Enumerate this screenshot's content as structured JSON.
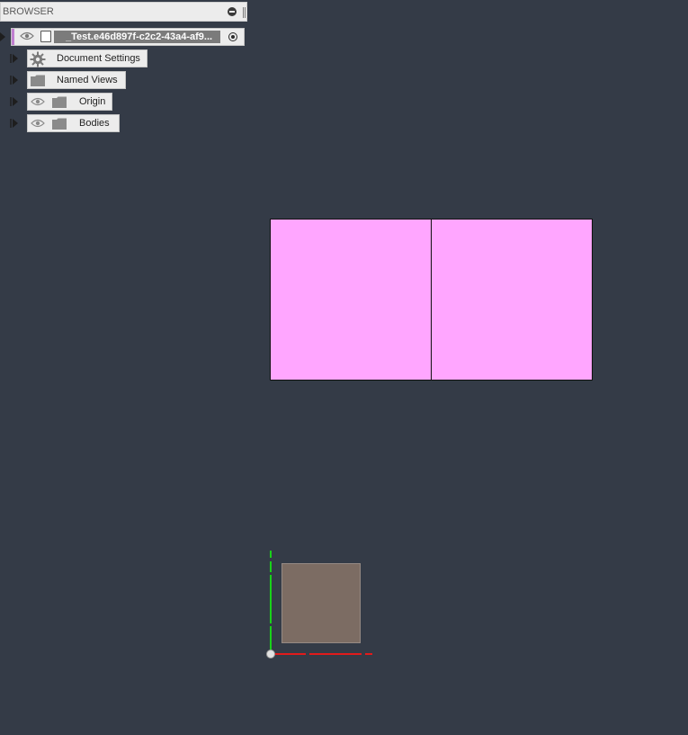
{
  "browser": {
    "title": "BROWSER",
    "root": {
      "label": "_Test.e46d897f-c2c2-43a4-af9...",
      "accent_color": "#c07fd0"
    },
    "nodes": [
      {
        "label": "Document Settings",
        "icon": "gear-icon",
        "has_eye": false
      },
      {
        "label": "Named Views",
        "icon": "folder-icon",
        "has_eye": false
      },
      {
        "label": "Origin",
        "icon": "folder-icon",
        "has_eye": true
      },
      {
        "label": "Bodies",
        "icon": "folder-icon",
        "has_eye": true
      }
    ]
  },
  "viewport": {
    "background_color": "#343b47",
    "body_color": "#ffa6ff",
    "sketch_color": "#7c6c63",
    "axis_x_color": "#e11b1b",
    "axis_y_color": "#19d119"
  }
}
